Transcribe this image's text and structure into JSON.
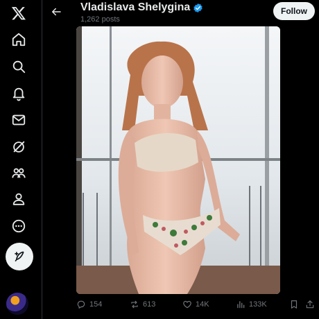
{
  "header": {
    "account_name": "Vladislava Shelygina",
    "post_count": "1,262 posts",
    "follow_label": "Follow"
  },
  "media": {
    "description_icon": "photo"
  },
  "actions": {
    "replies": "154",
    "reposts": "613",
    "likes": "14K",
    "views": "133K"
  },
  "colors": {
    "background": "#000000",
    "text_primary": "#e7e9ea",
    "text_secondary": "#71767b",
    "verified_blue": "#1d9bf0",
    "button_light": "#eff3f4"
  },
  "icons": {
    "sidebar": [
      "x-logo-icon",
      "home-icon",
      "search-icon",
      "notifications-icon",
      "messages-icon",
      "grok-icon",
      "communities-icon",
      "profile-icon",
      "more-icon"
    ],
    "compose": "compose-icon",
    "header": [
      "back-arrow-icon",
      "verified-badge-icon"
    ],
    "actions": [
      "reply-icon",
      "repost-icon",
      "like-icon",
      "views-icon",
      "bookmark-icon",
      "share-icon"
    ]
  }
}
